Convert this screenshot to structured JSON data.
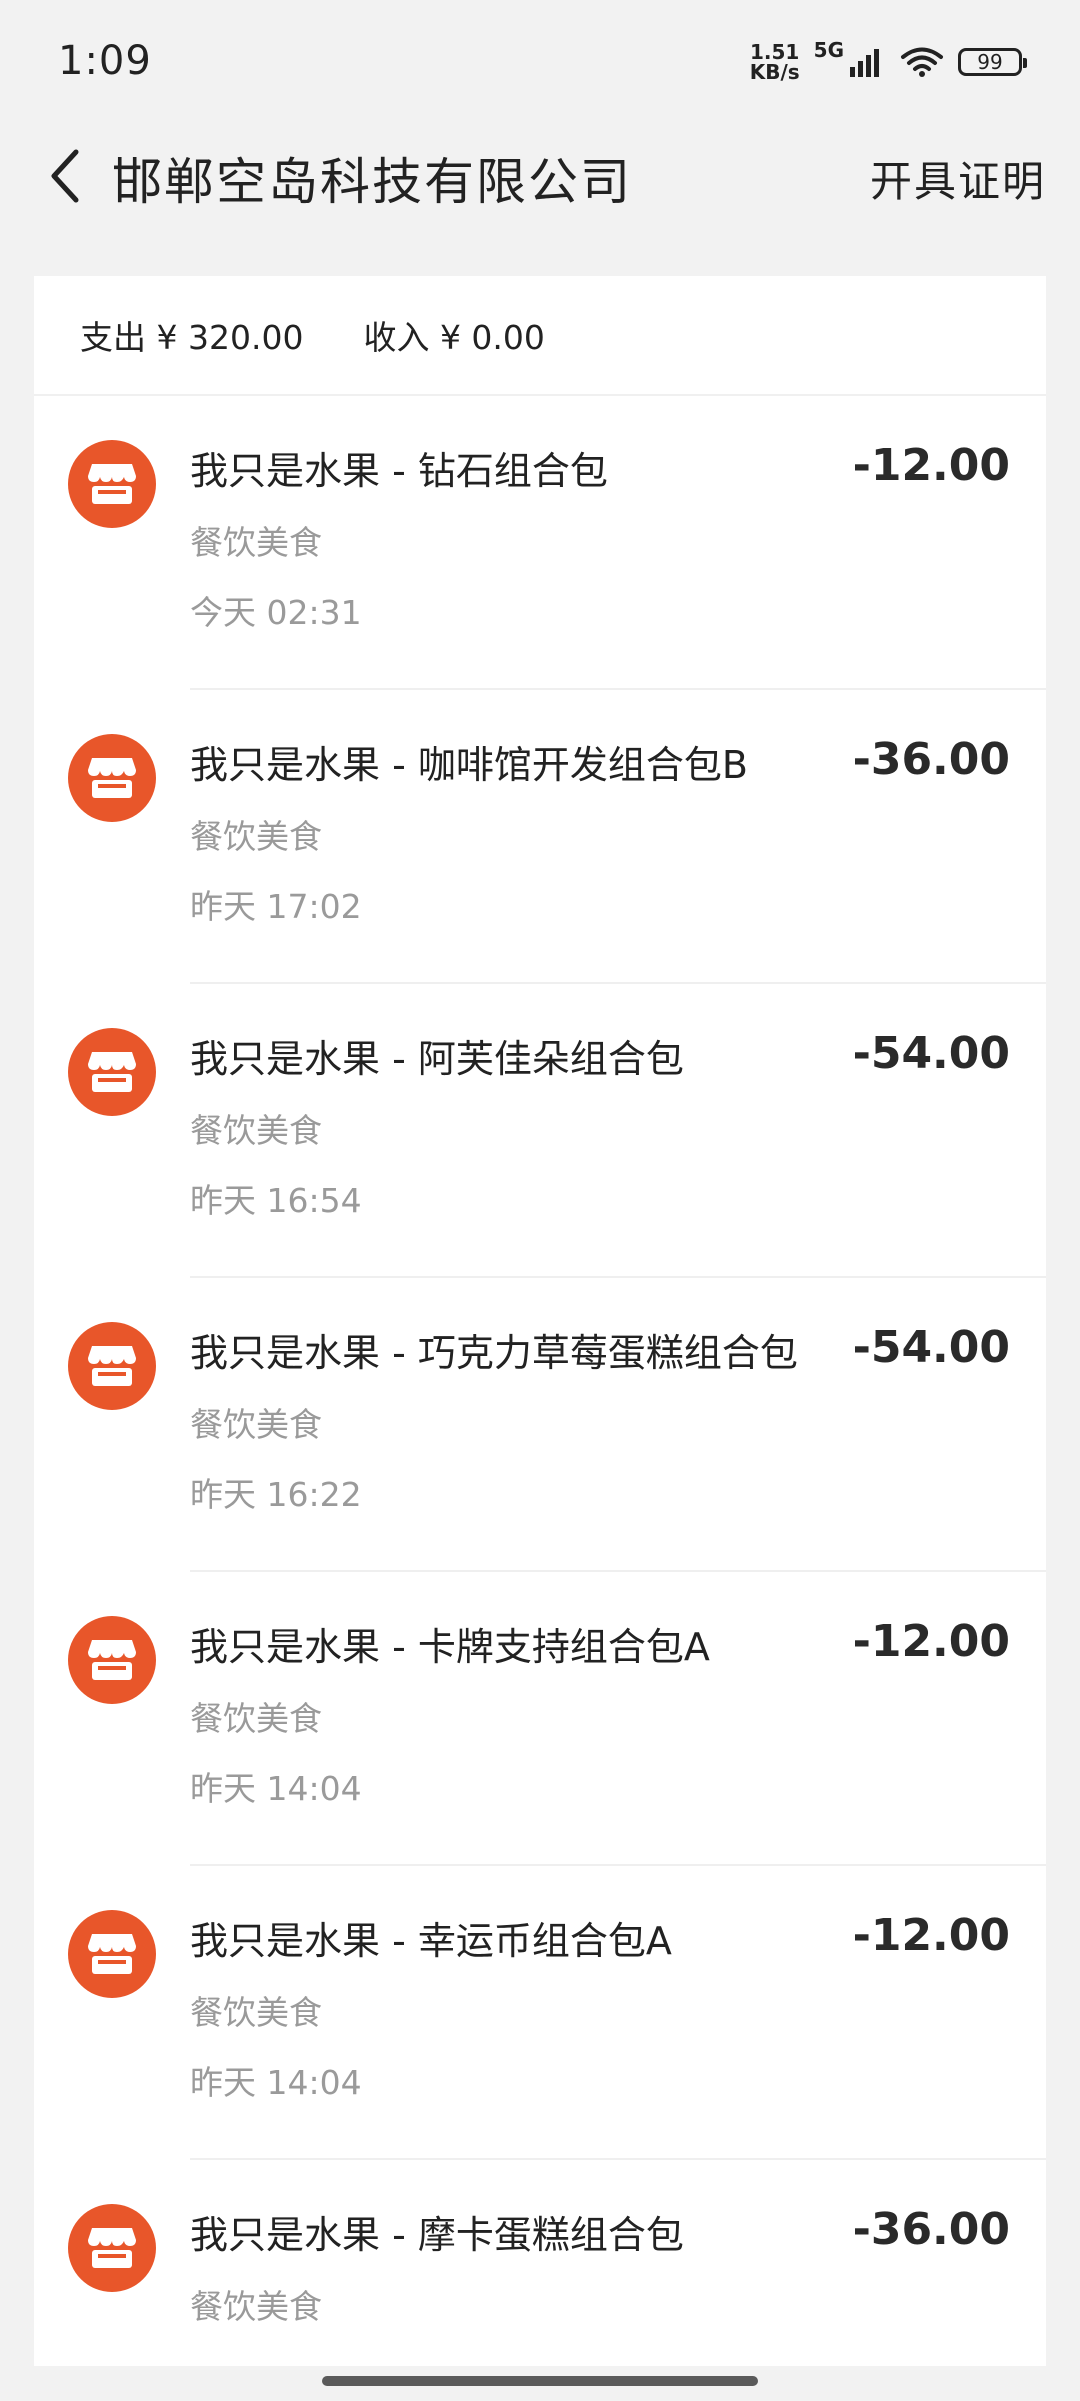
{
  "status_bar": {
    "time": "1:09",
    "net_speed_value": "1.51",
    "net_speed_unit": "KB/s",
    "network": "5G",
    "battery": "99"
  },
  "header": {
    "title": "邯郸空岛科技有限公司",
    "certificate_button": "开具证明"
  },
  "summary": {
    "expense": "支出 ¥ 320.00",
    "income": "收入 ¥ 0.00"
  },
  "transactions": [
    {
      "name": "我只是水果 - 钻石组合包",
      "category": "餐饮美食",
      "time": "今天 02:31",
      "amount": "-12.00"
    },
    {
      "name": "我只是水果 - 咖啡馆开发组合包B",
      "category": "餐饮美食",
      "time": "昨天 17:02",
      "amount": "-36.00"
    },
    {
      "name": "我只是水果 - 阿芙佳朵组合包",
      "category": "餐饮美食",
      "time": "昨天 16:54",
      "amount": "-54.00"
    },
    {
      "name": "我只是水果 - 巧克力草莓蛋糕组合包",
      "category": "餐饮美食",
      "time": "昨天 16:22",
      "amount": "-54.00"
    },
    {
      "name": "我只是水果 - 卡牌支持组合包A",
      "category": "餐饮美食",
      "time": "昨天 14:04",
      "amount": "-12.00"
    },
    {
      "name": "我只是水果 - 幸运币组合包A",
      "category": "餐饮美食",
      "time": "昨天 14:04",
      "amount": "-12.00"
    },
    {
      "name": "我只是水果 - 摩卡蛋糕组合包",
      "category": "餐饮美食",
      "time": "",
      "amount": "-36.00"
    }
  ],
  "colors": {
    "accent": "#e8562a",
    "background": "#f2f2f2",
    "card": "#ffffff",
    "secondary_text": "#9a9a9a"
  },
  "icons": {
    "back": "chevron-left-icon",
    "merchant": "shop-icon"
  }
}
